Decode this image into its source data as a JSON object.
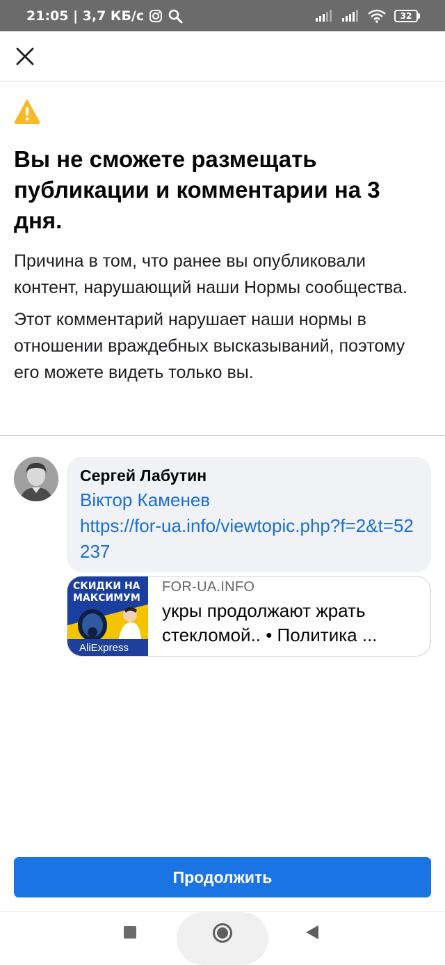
{
  "status_bar": {
    "time_speed": "21:05 | 3,7 КБ/с",
    "battery": "32"
  },
  "warning": {
    "headline": "Вы не сможете размещать публикации и комментарии на 3 дня.",
    "reason": "Причина в том, что ранее вы опубликовали контент, нарушающий наши Нормы сообщества.",
    "violation": "Этот комментарий нарушает наши нормы в отношении враждебных высказываний, поэтому его можете видеть только вы."
  },
  "comment": {
    "author": "Сергей Лабутин",
    "mention": "Віктор Каменев",
    "link": "https://for-ua.info/viewtopic.php?f=2&t=52237"
  },
  "link_preview": {
    "thumb_text_line1": "СКИДКИ НА",
    "thumb_text_line2": "МАКСИМУМ",
    "thumb_brand": "AliExpress",
    "domain": "FOR-UA.INFO",
    "title_line1": "укры продолжают жрать",
    "title_line2": "стекломой.. • Политика ..."
  },
  "footer": {
    "continue_label": "Продолжить"
  },
  "colors": {
    "accent": "#1b74e4",
    "link": "#1a6ed8",
    "warning": "#f7b928"
  }
}
